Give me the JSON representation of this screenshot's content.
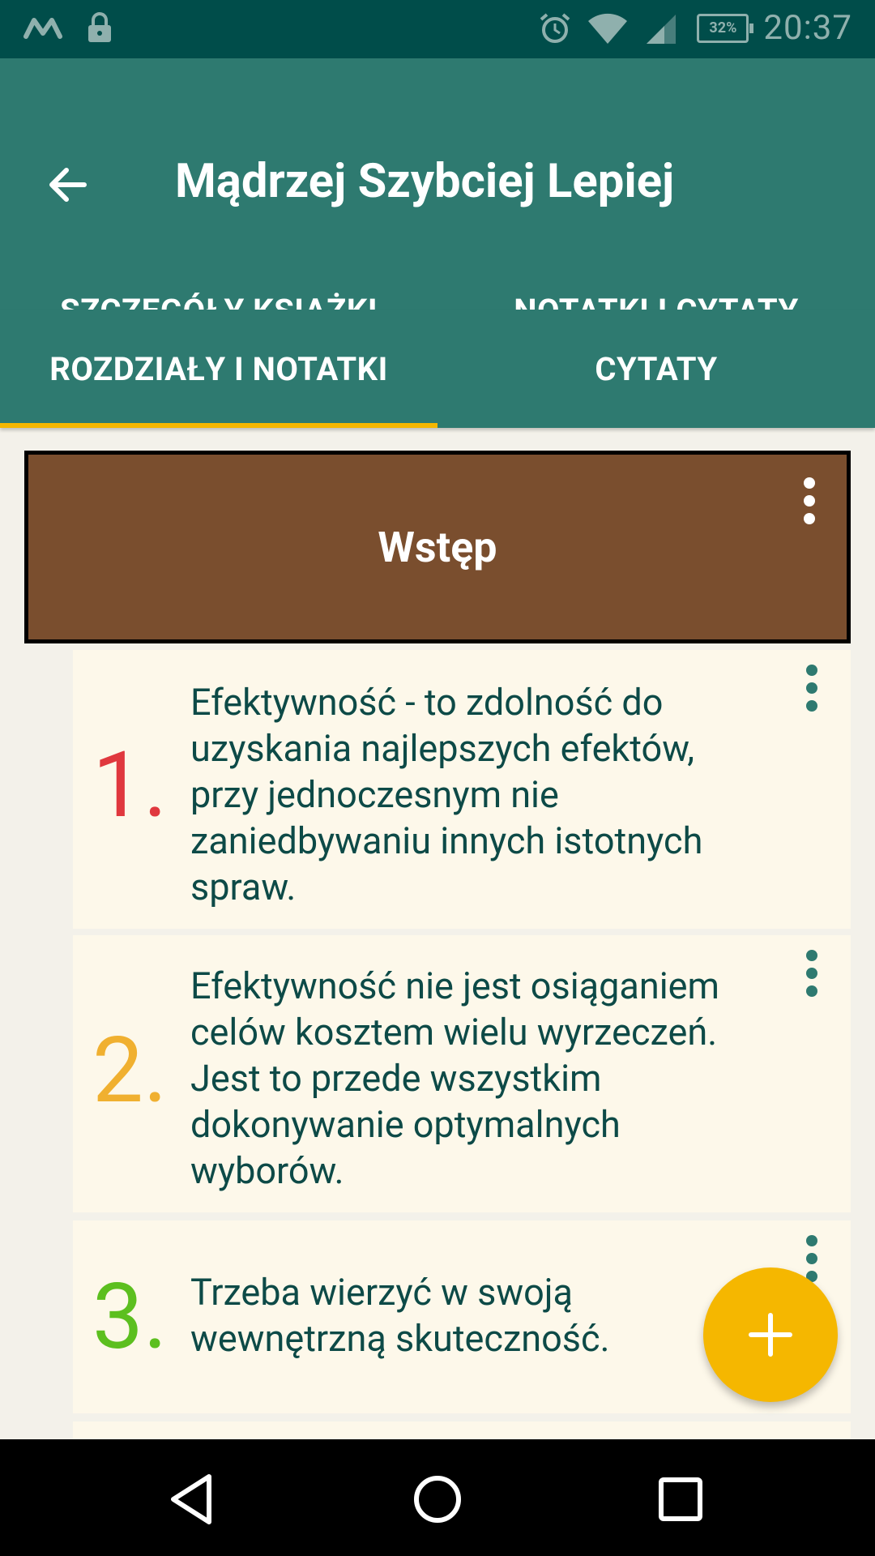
{
  "status_bar": {
    "time": "20:37",
    "battery": "32%",
    "icons": [
      "m-notification-icon",
      "lock-icon",
      "alarm-icon",
      "wifi-icon",
      "signal-icon",
      "battery-icon"
    ]
  },
  "app_bar": {
    "title": "Mądrzej Szybciej Lepiej",
    "back_icon": "arrow-left-icon"
  },
  "tabs_primary": [
    {
      "label": "SZCZEGÓŁY KSIĄŻKI",
      "active": false
    },
    {
      "label": "NOTATKI I CYTATY",
      "active": true
    }
  ],
  "tabs_secondary": [
    {
      "label": "ROZDZIAŁY I NOTATKI",
      "active": true
    },
    {
      "label": "CYTATY",
      "active": false
    }
  ],
  "chapter": {
    "title": "Wstęp",
    "menu_icon": "more-vert-icon"
  },
  "notes": [
    {
      "number": "1.",
      "color": "#e0383e",
      "text": "Efektywność - to zdolność do uzyskania najlepszych efektów, przy jednoczesnym nie zaniedbywaniu innych istotnych spraw."
    },
    {
      "number": "2.",
      "color": "#f0b030",
      "text": "Efektywność nie jest osiąganiem celów kosztem wielu wyrzeczeń. Jest to przede wszystkim dokonywanie optymalnych wyborów."
    },
    {
      "number": "3.",
      "color": "#5cbf1f",
      "text": "Trzeba wierzyć w swoją wewnętrzną skuteczność."
    }
  ],
  "fab": {
    "icon": "plus-icon"
  },
  "colors": {
    "status_bar": "#004d4a",
    "primary": "#2e7a70",
    "accent": "#f5b700",
    "chapter_bg": "#7a4e2e",
    "note_bg": "#fdf8ea",
    "note_text": "#0d4a47"
  },
  "nav_bar": {
    "icons": [
      "back-triangle-icon",
      "home-circle-icon",
      "recents-square-icon"
    ]
  }
}
